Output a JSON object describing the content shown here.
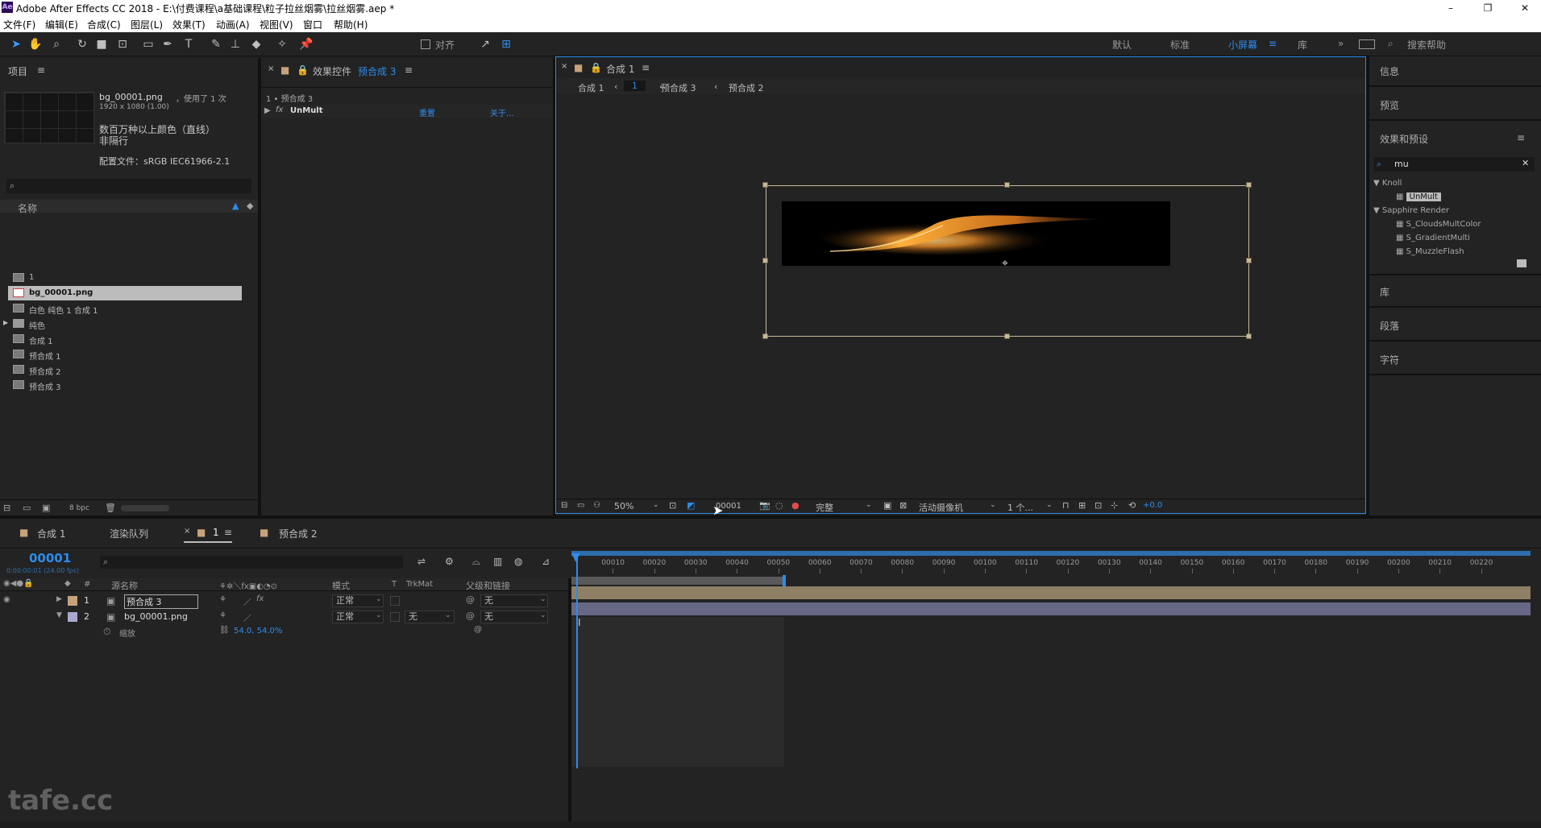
{
  "window": {
    "title": "Adobe After Effects CC 2018 - E:\\付费课程\\a基础课程\\粒子拉丝烟雾\\拉丝烟雾.aep *",
    "app_icon": "Ae",
    "controls": [
      "–",
      "❐",
      "✕"
    ]
  },
  "menu": [
    "文件(F)",
    "编辑(E)",
    "合成(C)",
    "图层(L)",
    "效果(T)",
    "动画(A)",
    "视图(V)",
    "窗口",
    "帮助(H)"
  ],
  "toolbar": {
    "align_label": "对齐",
    "workspaces": [
      "默认",
      "标准",
      "小屏幕",
      "库"
    ],
    "active_workspace": "小屏幕",
    "search_help": "搜索帮助",
    "accent": "#2d8ceb"
  },
  "project": {
    "tab": "项目",
    "item_name": "bg_00001.png",
    "item_used": "，使用了 1 次",
    "item_dims": "1920 x 1080 (1.00)",
    "color_info": "数百万种以上颜色（直线）",
    "color_info2": "非隔行",
    "profile": "配置文件：sRGB IEC61966-2.1",
    "col_name": "名称",
    "items": [
      {
        "label": "1",
        "selected": false
      },
      {
        "label": "bg_00001.png",
        "selected": true
      },
      {
        "label": "白色 纯色 1 合成 1",
        "selected": false
      },
      {
        "label": "纯色",
        "selected": false
      },
      {
        "label": "合成 1",
        "selected": false
      },
      {
        "label": "预合成 1",
        "selected": false
      },
      {
        "label": "预合成 2",
        "selected": false
      },
      {
        "label": "预合成 3",
        "selected": false
      }
    ],
    "bpc": "8 bpc"
  },
  "effects": {
    "tab_label": "效果控件",
    "tab_target": "预合成 3",
    "breadcrumb": "1 • 预合成 3",
    "fx_label": "fx",
    "effect_name": "UnMult",
    "reset": "重置",
    "about": "关于..."
  },
  "comp": {
    "tab": "合成 1",
    "crumbs": [
      "合成 1",
      "1",
      "预合成 3",
      "预合成 2"
    ],
    "zoom": "50%",
    "timecode": "00001",
    "quality": "完整",
    "camera": "活动摄像机",
    "views": "1 个...",
    "exposure": "+0.0"
  },
  "right": {
    "info": "信息",
    "preview": "预览",
    "effects_presets": "效果和预设",
    "search_value": "mu",
    "groups": [
      {
        "name": "Knoll",
        "items": [
          "UnMult"
        ]
      },
      {
        "name": "Sapphire Render",
        "items": [
          "S_CloudsMultColor",
          "S_GradientMulti",
          "S_MuzzleFlash"
        ]
      }
    ],
    "library": "库",
    "paragraph": "段落",
    "character": "字符"
  },
  "timeline": {
    "tabs": [
      "合成 1",
      "渲染队列",
      "1",
      "预合成 2"
    ],
    "timecode": "00001",
    "timecode_sub": "0:00:00:01 (24.00 fps)",
    "col_source": "源名称",
    "col_mode": "模式",
    "col_t": "T",
    "col_trkmat": "TrkMat",
    "col_parent": "父级和链接",
    "layers": [
      {
        "num": "1",
        "name": "预合成 3",
        "mode": "正常",
        "trkmat": "",
        "parent": "无"
      },
      {
        "num": "2",
        "name": "bg_00001.png",
        "mode": "正常",
        "trkmat": "无",
        "parent": "无"
      }
    ],
    "prop_name": "缩放",
    "prop_value": "54.0, 54.0%",
    "ruler": [
      "00010",
      "00020",
      "00030",
      "00040",
      "00050",
      "00060",
      "00070",
      "00080",
      "00090",
      "00100",
      "00110",
      "00120",
      "00130",
      "00140",
      "00150",
      "00160",
      "00170",
      "00180",
      "00190",
      "00200",
      "00210",
      "00220"
    ]
  },
  "watermark": "tafe.cc"
}
